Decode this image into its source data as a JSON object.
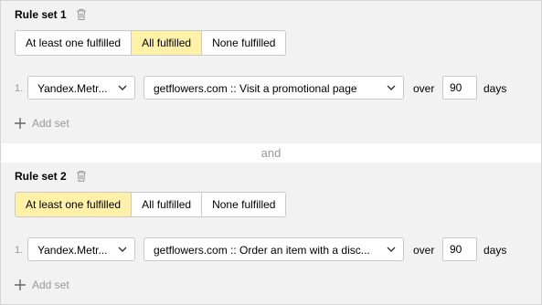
{
  "rule_sets": [
    {
      "title": "Rule set 1",
      "segments": [
        "At least one fulfilled",
        "All fulfilled",
        "None fulfilled"
      ],
      "active_segment": "All fulfilled",
      "condition": {
        "index": "1.",
        "source": "Yandex.Metr...",
        "goal": "getflowers.com :: Visit a promotional page",
        "over_label": "over",
        "days_value": "90",
        "days_label": "days"
      },
      "add_set_label": "Add set"
    },
    {
      "title": "Rule set 2",
      "segments": [
        "At least one fulfilled",
        "All fulfilled",
        "None fulfilled"
      ],
      "active_segment": "At least one fulfilled",
      "condition": {
        "index": "1.",
        "source": "Yandex.Metr...",
        "goal": "getflowers.com :: Order an item with a disc...",
        "over_label": "over",
        "days_value": "90",
        "days_label": "days"
      },
      "add_set_label": "Add set"
    }
  ],
  "separator_label": "and",
  "colors": {
    "active_segment_bg": "#fff2a8",
    "panel_bg": "#f2f2f2",
    "muted_text": "#999999",
    "border": "#c9c9c9"
  }
}
